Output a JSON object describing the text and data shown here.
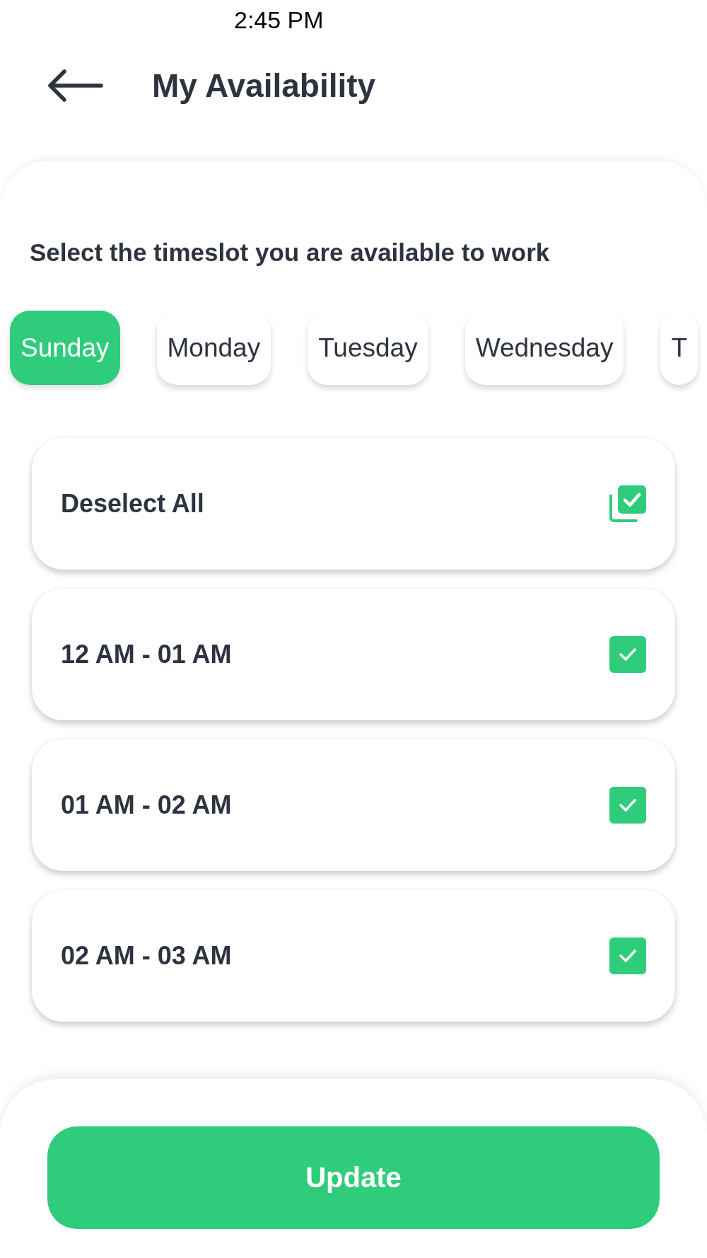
{
  "status_bar": {
    "time": "2:45 PM"
  },
  "header": {
    "title": "My Availability"
  },
  "instruction": "Select the timeslot you are available to work",
  "days": [
    {
      "label": "Sunday",
      "selected": true
    },
    {
      "label": "Monday",
      "selected": false
    },
    {
      "label": "Tuesday",
      "selected": false
    },
    {
      "label": "Wednesday",
      "selected": false
    },
    {
      "label": "T",
      "selected": false
    }
  ],
  "select_all": {
    "label": "Deselect All",
    "checked": true
  },
  "timeslots": [
    {
      "label": "12 AM - 01 AM",
      "checked": true
    },
    {
      "label": "01 AM - 02 AM",
      "checked": true
    },
    {
      "label": "02 AM - 03 AM",
      "checked": true
    }
  ],
  "update_button": {
    "label": "Update"
  }
}
